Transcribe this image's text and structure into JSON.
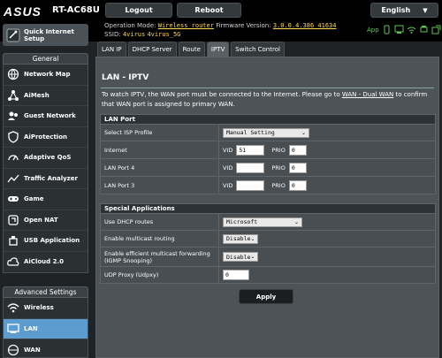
{
  "brand": "ASUS",
  "model": "RT-AC68U",
  "header": {
    "logout": "Logout",
    "reboot": "Reboot",
    "language": "English",
    "op_mode_label": "Operation Mode:",
    "op_mode_value": "Wireless router",
    "fw_label": "Firmware Version:",
    "fw_value": "3.0.0.4.386_41634",
    "ssid_label": "SSID:",
    "ssid_1": "4virus",
    "ssid_2": "4virus_5G",
    "app_label": "App"
  },
  "sidebar": {
    "qis_label": "Quick Internet Setup",
    "general_heading": "General",
    "general_items": [
      {
        "label": "Network Map"
      },
      {
        "label": "AiMesh"
      },
      {
        "label": "Guest Network"
      },
      {
        "label": "AiProtection"
      },
      {
        "label": "Adaptive QoS"
      },
      {
        "label": "Traffic Analyzer"
      },
      {
        "label": "Game"
      },
      {
        "label": "Open NAT"
      },
      {
        "label": "USB Application"
      },
      {
        "label": "AiCloud 2.0"
      }
    ],
    "advanced_heading": "Advanced Settings",
    "advanced_items": [
      {
        "label": "Wireless"
      },
      {
        "label": "LAN"
      },
      {
        "label": "WAN"
      }
    ]
  },
  "tabs": [
    {
      "label": "LAN IP"
    },
    {
      "label": "DHCP Server"
    },
    {
      "label": "Route"
    },
    {
      "label": "IPTV"
    },
    {
      "label": "Switch Control"
    }
  ],
  "main": {
    "title": "LAN - IPTV",
    "desc_pre": "To watch IPTV, the WAN port must be connected to the Internet. Please go to ",
    "desc_link": "WAN - Dual WAN",
    "desc_post": " to confirm that WAN port is assigned to primary WAN.",
    "lan_port": {
      "heading": "LAN Port",
      "isp_profile_label": "Select ISP Profile",
      "isp_profile_value": "Manual Setting",
      "vid_label": "VID",
      "prio_label": "PRIO",
      "internet_label": "Internet",
      "internet_vid": "51",
      "internet_prio": "0",
      "lan4_label": "LAN Port 4",
      "lan4_vid": "",
      "lan4_prio": "0",
      "lan3_label": "LAN Port 3",
      "lan3_vid": "",
      "lan3_prio": "0"
    },
    "special": {
      "heading": "Special Applications",
      "dhcp_routes_label": "Use DHCP routes",
      "dhcp_routes_value": "Microsoft",
      "multicast_label": "Enable multicast routing",
      "multicast_value": "Disable",
      "igmp_label": "Enable efficient multicast forwarding (IGMP Snooping)",
      "igmp_value": "Disable",
      "udpxy_label": "UDP Proxy (Udpxy)",
      "udpxy_value": "0"
    },
    "apply": "Apply"
  },
  "colors": {
    "accent_active": "#5d9ccf",
    "status_green": "#5cc44e",
    "highlight_yellow": "#ffd84f"
  }
}
